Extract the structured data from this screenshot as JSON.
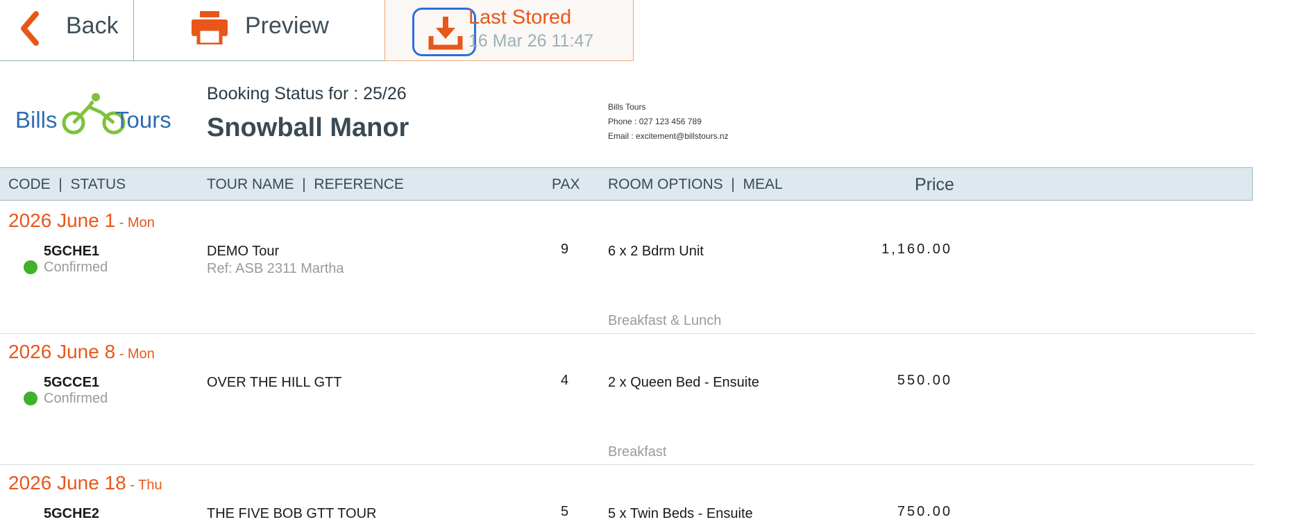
{
  "toolbar": {
    "back_label": "Back",
    "preview_label": "Preview",
    "stored_title": "Last Stored",
    "stored_time": "16 Mar 26 11:47"
  },
  "logo": {
    "text_left": "Bills",
    "text_right": "Tours"
  },
  "header": {
    "booking_for": "Booking Status for : 25/26",
    "hotel_name": "Snowball Manor",
    "company_name": "Bills Tours",
    "phone": "Phone : 027 123 456 789",
    "email": "Email : excitement@billstours.nz"
  },
  "columns": {
    "code_status": "CODE  |  STATUS",
    "tour_reference": "TOUR NAME  |  REFERENCE",
    "pax": "PAX",
    "room_meal": "ROOM OPTIONS  |  MEAL",
    "price": "Price"
  },
  "bookings": [
    {
      "date": "2026 June 1",
      "dow": " - Mon",
      "code": "5GCHE1",
      "status": "Confirmed",
      "tour": "DEMO Tour",
      "reference": "Ref: ASB 2311 Martha",
      "pax": "9",
      "room": "6 x 2 Bdrm Unit",
      "meal": "Breakfast & Lunch",
      "price": "1,160.00"
    },
    {
      "date": "2026 June 8",
      "dow": " - Mon",
      "code": "5GCCE1",
      "status": "Confirmed",
      "tour": "OVER THE HILL GTT",
      "reference": "",
      "pax": "4",
      "room": "2 x Queen Bed - Ensuite",
      "meal": "Breakfast",
      "price": "550.00"
    },
    {
      "date": "2026 June 18",
      "dow": " - Thu",
      "code": "5GCHE2",
      "status": "",
      "tour": "THE FIVE BOB GTT TOUR",
      "reference": "",
      "pax": "5",
      "room": "5 x Twin Beds - Ensuite",
      "meal": "",
      "price": "750.00"
    }
  ],
  "colors": {
    "accent": "#e8561a",
    "confirmed": "#3fb12a",
    "header_bg": "#dde9ee",
    "focus_ring": "#2a6fdb"
  },
  "icons": {
    "back": "chevron-left-icon",
    "preview": "printer-icon",
    "stored": "download-icon"
  }
}
